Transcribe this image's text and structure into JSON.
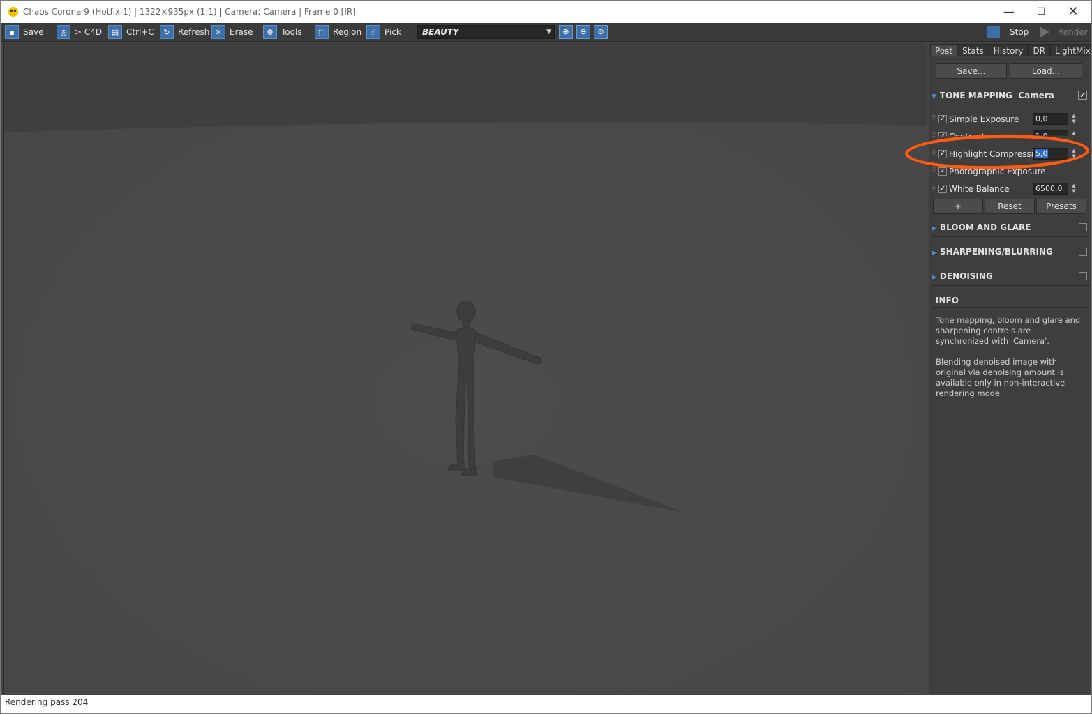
{
  "window": {
    "title": "Chaos Corona 9 (Hotfix 1) | 1322×935px (1:1) | Camera: Camera | Frame 0 [IR]",
    "controls": {
      "minimize": "—",
      "maximize": "☐",
      "close": "✕"
    }
  },
  "toolbar": {
    "save": "Save",
    "c4d": "> C4D",
    "copy": "Ctrl+C",
    "refresh": "Refresh",
    "erase": "Erase",
    "tools": "Tools",
    "region": "Region",
    "pick": "Pick",
    "channel": "BEAUTY",
    "stop": "Stop",
    "render": "Render"
  },
  "panel": {
    "tabs": [
      "Post",
      "Stats",
      "History",
      "DR",
      "LightMix"
    ],
    "save_btn": "Save...",
    "load_btn": "Load...",
    "tone_mapping": {
      "title": "TONE MAPPING",
      "sync": "Camera",
      "enabled": true
    },
    "rows": [
      {
        "label": "Simple Exposure",
        "value": "0,0",
        "checked": true
      },
      {
        "label": "Contrast",
        "value": "1,0",
        "checked": true
      },
      {
        "label": "Highlight Compression",
        "value": "5,0",
        "checked": true
      },
      {
        "label": "Photographic Exposure",
        "value": "",
        "checked": true
      },
      {
        "label": "White Balance",
        "value": "6500,0",
        "checked": true
      }
    ],
    "add_btn": "+",
    "reset_btn": "Reset",
    "presets_btn": "Presets",
    "sections": [
      "BLOOM AND GLARE",
      "SHARPENING/BLURRING",
      "DENOISING"
    ],
    "info_title": "INFO",
    "info_1": "Tone mapping, bloom and glare and sharpening controls are synchronized with 'Camera'.",
    "info_2": "Blending denoised image with original via denoising amount is available only in non-interactive rendering mode"
  },
  "status": {
    "text": "Rendering pass 204"
  },
  "colors": {
    "accent": "#3d6fa8",
    "highlight_ring": "#ff5a12",
    "viewport_bg": "#4a4a4a"
  },
  "icons": [
    "save-icon",
    "c4d-icon",
    "copy-icon",
    "refresh-icon",
    "erase-icon",
    "tools-gear-icon",
    "region-icon",
    "pick-hand-icon",
    "zoom-in-icon",
    "zoom-out-icon",
    "zoom-fit-icon",
    "stop-icon",
    "render-play-icon"
  ]
}
